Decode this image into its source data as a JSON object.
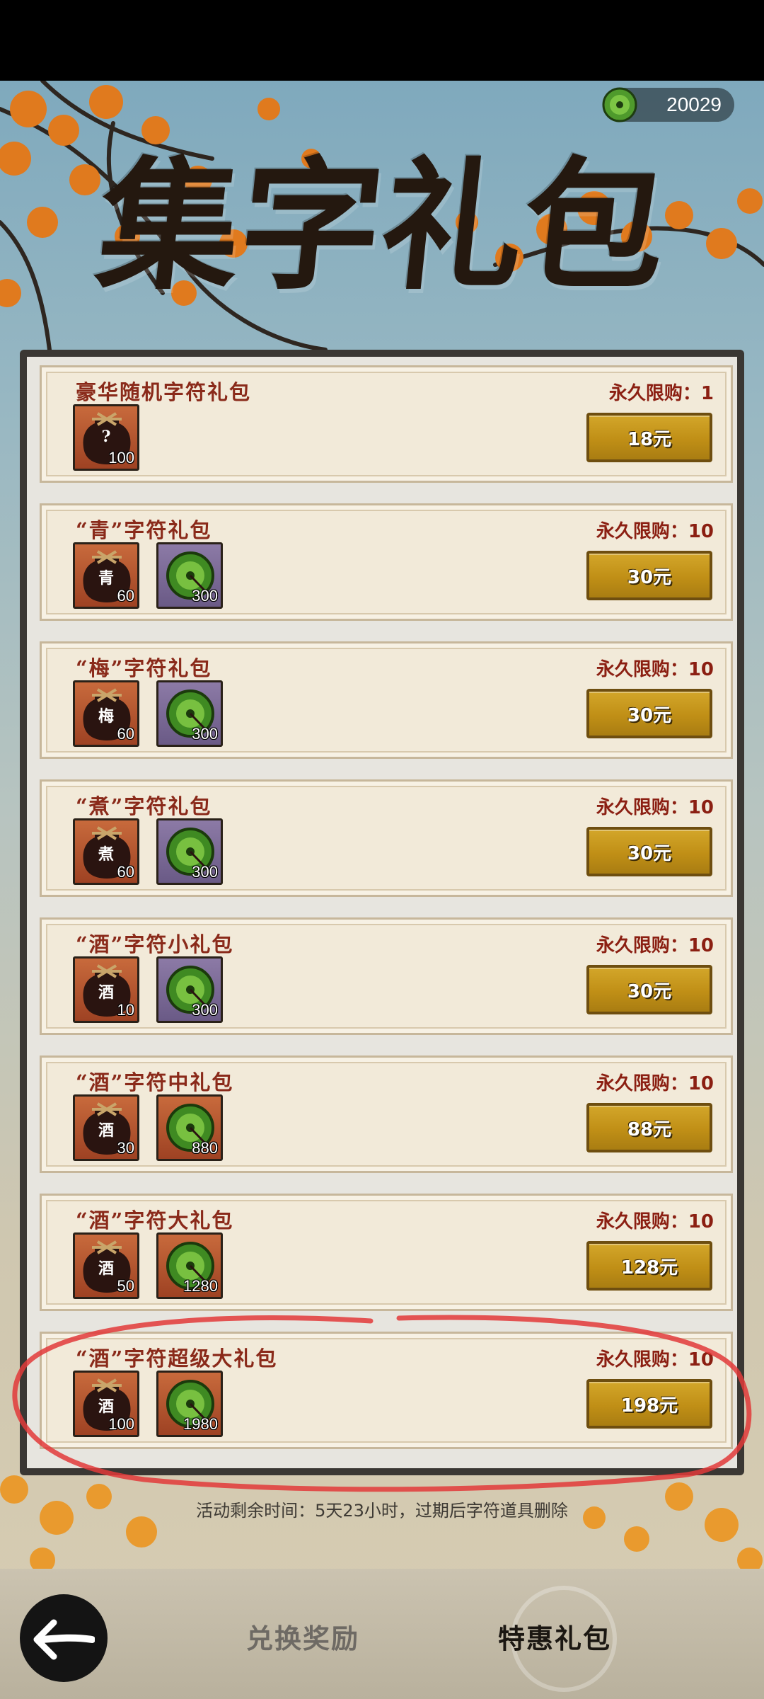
{
  "header": {
    "coin_amount": "20029",
    "coin_icon": "jade-coin-icon",
    "title_chars": [
      "集",
      "字",
      "礼",
      "包"
    ]
  },
  "packs": [
    {
      "title": "豪华随机字符礼包",
      "limit": "永久限购：1",
      "price": "18元",
      "items": [
        {
          "icon": "wine-jar-icon",
          "char": "?",
          "qty": "100"
        }
      ]
    },
    {
      "title": "“青”字符礼包",
      "limit": "永久限购：10",
      "price": "30元",
      "items": [
        {
          "icon": "wine-jar-icon",
          "char": "青",
          "qty": "60"
        },
        {
          "icon": "jade-coin-icon",
          "qty": "300"
        }
      ]
    },
    {
      "title": "“梅”字符礼包",
      "limit": "永久限购：10",
      "price": "30元",
      "items": [
        {
          "icon": "wine-jar-icon",
          "char": "梅",
          "qty": "60"
        },
        {
          "icon": "jade-coin-icon",
          "qty": "300"
        }
      ]
    },
    {
      "title": "“煮”字符礼包",
      "limit": "永久限购：10",
      "price": "30元",
      "items": [
        {
          "icon": "wine-jar-icon",
          "char": "煮",
          "qty": "60"
        },
        {
          "icon": "jade-coin-icon",
          "qty": "300"
        }
      ]
    },
    {
      "title": "“酒”字符小礼包",
      "limit": "永久限购：10",
      "price": "30元",
      "items": [
        {
          "icon": "wine-jar-icon",
          "char": "酒",
          "qty": "10"
        },
        {
          "icon": "jade-coin-icon",
          "qty": "300"
        }
      ]
    },
    {
      "title": "“酒”字符中礼包",
      "limit": "永久限购：10",
      "price": "88元",
      "items": [
        {
          "icon": "wine-jar-icon",
          "char": "酒",
          "qty": "30"
        },
        {
          "icon": "jade-coin-icon",
          "qty": "880"
        }
      ]
    },
    {
      "title": "“酒”字符大礼包",
      "limit": "永久限购：10",
      "price": "128元",
      "items": [
        {
          "icon": "wine-jar-icon",
          "char": "酒",
          "qty": "50"
        },
        {
          "icon": "jade-coin-icon",
          "qty": "1280"
        }
      ]
    },
    {
      "title": "“酒”字符超级大礼包",
      "limit": "永久限购：10",
      "price": "198元",
      "items": [
        {
          "icon": "wine-jar-icon",
          "char": "酒",
          "qty": "100"
        },
        {
          "icon": "jade-coin-icon",
          "qty": "1980"
        }
      ]
    }
  ],
  "footer": {
    "timer_text": "活动剩余时间：5天23小时，过期后字符道具删除",
    "tabs": [
      {
        "label": "兑换奖励"
      },
      {
        "label": "特惠礼包"
      }
    ],
    "back_icon": "back-arrow-icon"
  }
}
